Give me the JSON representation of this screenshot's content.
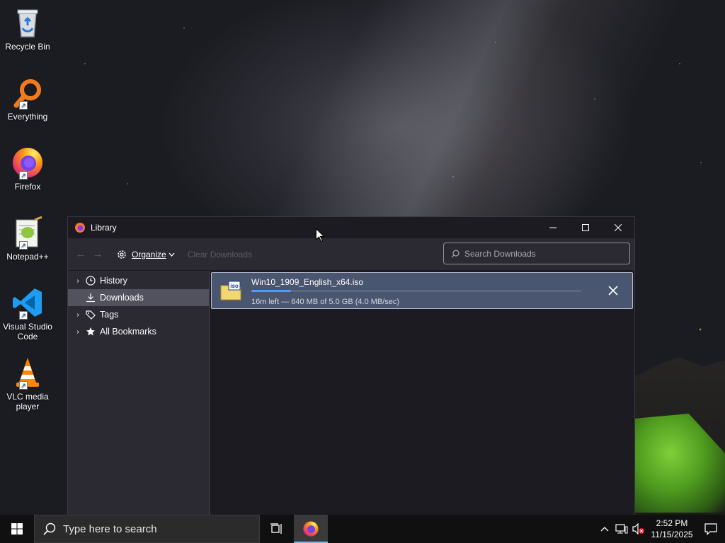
{
  "desktop": {
    "icons": [
      {
        "label": "Recycle Bin",
        "icon": "recycle-bin-icon"
      },
      {
        "label": "Everything",
        "icon": "everything-search-icon"
      },
      {
        "label": "Firefox",
        "icon": "firefox-icon"
      },
      {
        "label": "Notepad++",
        "icon": "notepad-plus-plus-icon"
      },
      {
        "label": "Visual Studio Code",
        "icon": "vscode-icon"
      },
      {
        "label": "VLC media player",
        "icon": "vlc-icon"
      }
    ]
  },
  "window": {
    "title": "Library",
    "toolbar": {
      "organize_label": "Organize",
      "clear_label": "Clear Downloads",
      "search_placeholder": "Search Downloads"
    },
    "sidebar": {
      "items": [
        {
          "label": "History",
          "icon": "clock-icon",
          "expandable": true
        },
        {
          "label": "Downloads",
          "icon": "download-icon",
          "expandable": false,
          "selected": true
        },
        {
          "label": "Tags",
          "icon": "tags-icon",
          "expandable": true
        },
        {
          "label": "All Bookmarks",
          "icon": "star-icon",
          "expandable": true
        }
      ]
    },
    "downloads": [
      {
        "filename": "Win10_1909_English_x64.iso",
        "file_icon_text": "iso",
        "status": "16m left — 640 MB of 5.0 GB (4.0 MB/sec)",
        "progress_fraction": 0.12
      }
    ]
  },
  "taskbar": {
    "search_placeholder": "Type here to search",
    "clock_time": "2:52 PM",
    "clock_date": "11/15/2025"
  },
  "colors": {
    "accent": "#4a9cff",
    "selected_download_bg": "#4a5570",
    "window_bg": "#1c1b22"
  }
}
